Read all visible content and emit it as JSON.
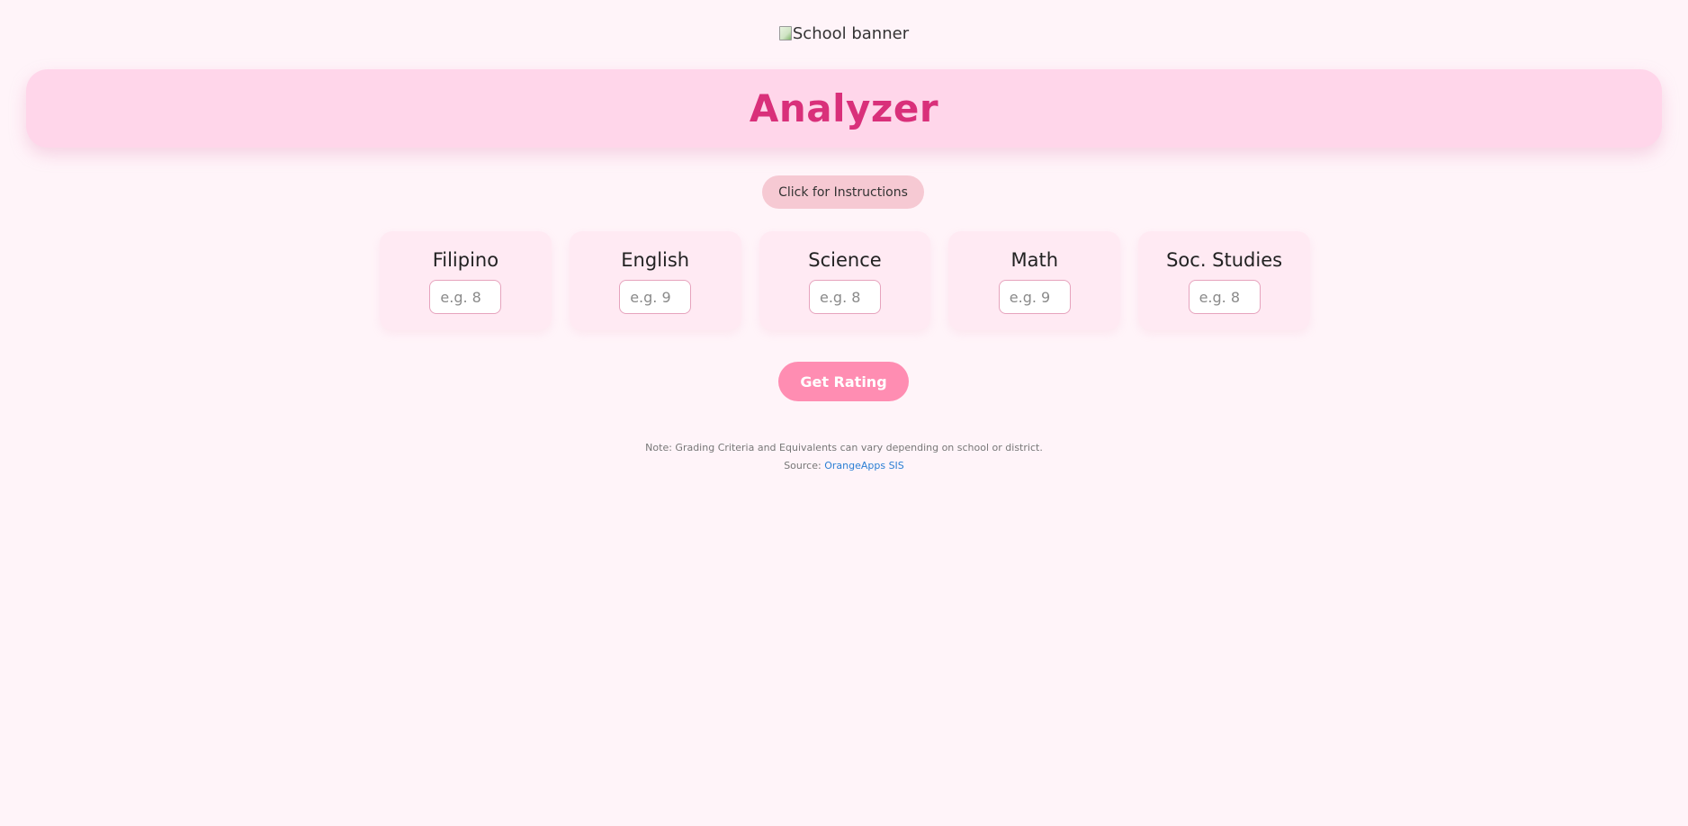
{
  "banner": {
    "alt_text": "School banner"
  },
  "header": {
    "title": "Analyzer"
  },
  "instructions_button": {
    "label": "Click for Instructions"
  },
  "subjects": [
    {
      "label": "Filipino",
      "placeholder": "e.g. 8"
    },
    {
      "label": "English",
      "placeholder": "e.g. 9"
    },
    {
      "label": "Science",
      "placeholder": "e.g. 8"
    },
    {
      "label": "Math",
      "placeholder": "e.g. 9"
    },
    {
      "label": "Soc. Studies",
      "placeholder": "e.g. 8"
    }
  ],
  "rating_button": {
    "label": "Get Rating"
  },
  "footer": {
    "note": "Note: Grading Criteria and Equivalents can vary depending on school or district.",
    "source_prefix": "Source:",
    "source_link_text": "OrangeApps SIS"
  },
  "colors": {
    "page_background": "#fff4f9",
    "hero_background": "#ffd6ea",
    "title": "#d9307a",
    "instructions_button": "#f6c9d3",
    "rating_button": "#ff8db2",
    "link": "#2a7fd4"
  },
  "icons": {
    "banner": "broken-image-icon"
  }
}
